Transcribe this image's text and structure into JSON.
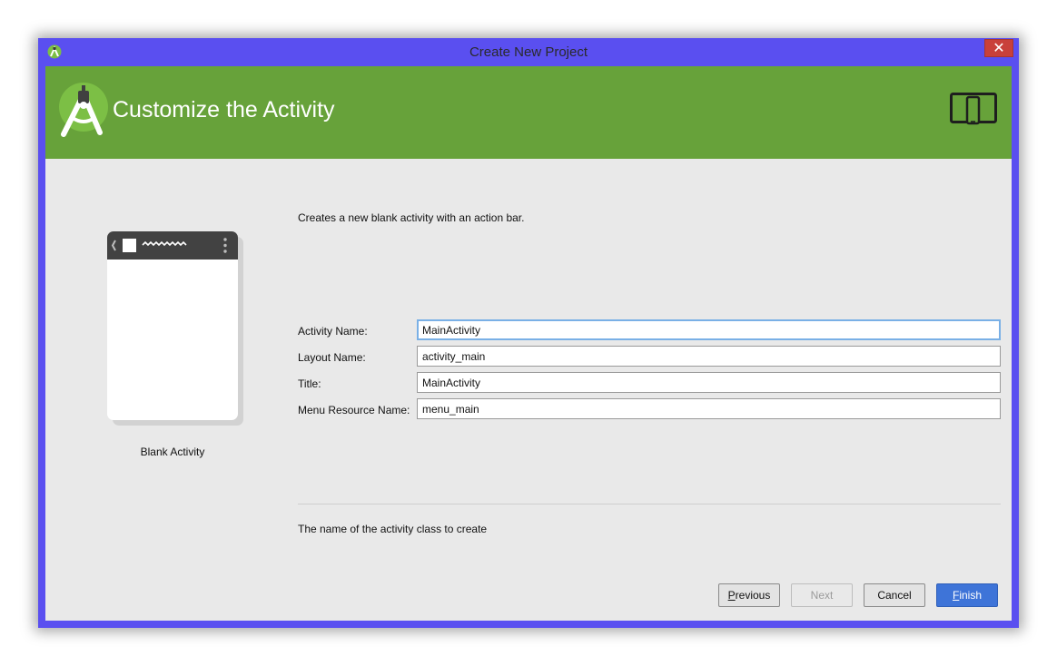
{
  "window": {
    "title": "Create New Project",
    "close_label": "✕"
  },
  "header": {
    "title": "Customize the Activity",
    "logo_icon": "android-studio-logo-icon",
    "form_factor_icon": "phone-tablet-icon"
  },
  "template": {
    "caption": "Blank Activity",
    "preview_icon": "blank-activity-preview"
  },
  "description": "Creates a new blank activity with an action bar.",
  "form": {
    "fields": [
      {
        "label": "Activity Name:",
        "value": "MainActivity"
      },
      {
        "label": "Layout Name:",
        "value": "activity_main"
      },
      {
        "label": "Title:",
        "value": "MainActivity"
      },
      {
        "label": "Menu Resource Name:",
        "value": "menu_main"
      }
    ]
  },
  "help_text": "The name of the activity class to create",
  "buttons": {
    "previous": {
      "mnemonic": "P",
      "rest": "revious"
    },
    "next": {
      "label": "Next"
    },
    "cancel": {
      "label": "Cancel"
    },
    "finish": {
      "mnemonic": "F",
      "rest": "inish"
    }
  },
  "colors": {
    "window_frame": "#5a4ff0",
    "banner": "#67a23a",
    "close_button": "#c9403a",
    "primary_button": "#3e74d8",
    "focus_ring": "#7ab0e6"
  }
}
